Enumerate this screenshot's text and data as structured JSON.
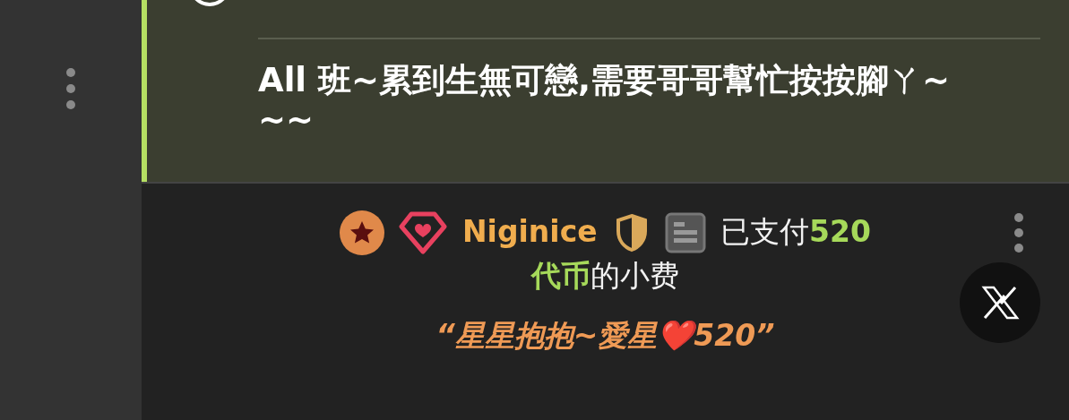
{
  "message": {
    "text": "All 班~累到生無可戀,需要哥哥幫忙按按腳ㄚ~~~"
  },
  "tip": {
    "username": "Niginice",
    "text_lines": [
      "已支付**520**",
      "**代币**的小费"
    ],
    "quote": "“星星抱抱~愛星❤️520”"
  }
}
